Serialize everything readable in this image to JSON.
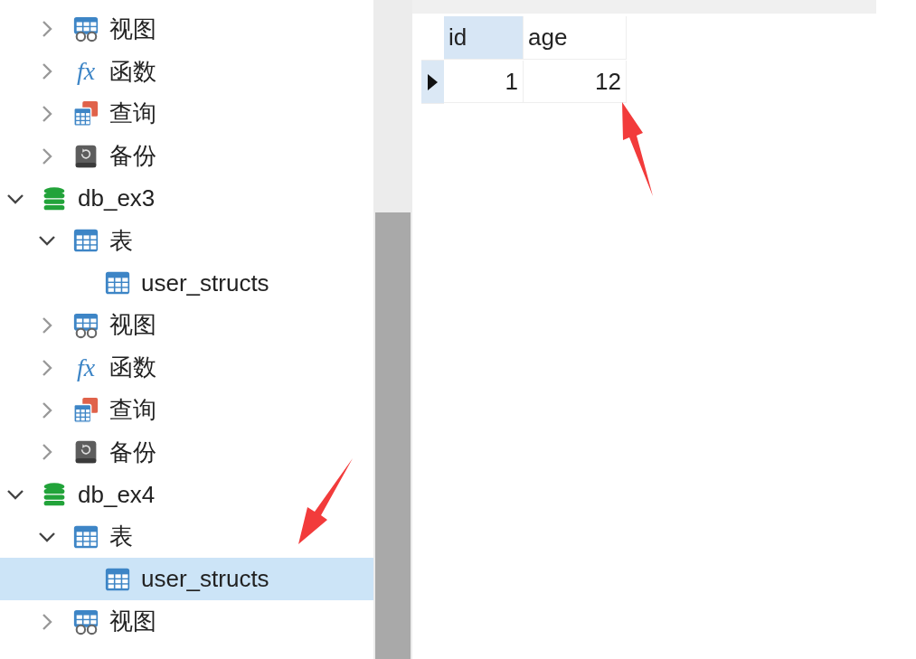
{
  "navigator": {
    "partial_group": [
      {
        "kind": "views",
        "label": "视图",
        "expanded": false,
        "selected": false
      },
      {
        "kind": "functions",
        "label": "函数",
        "glyph": "fx",
        "expanded": false,
        "selected": false
      },
      {
        "kind": "queries",
        "label": "查询",
        "expanded": false,
        "selected": false
      },
      {
        "kind": "backups",
        "label": "备份",
        "expanded": false,
        "selected": false
      }
    ],
    "databases": [
      {
        "kind": "database",
        "label": "db_ex3",
        "expanded": true,
        "selected": false,
        "children": [
          {
            "kind": "tables",
            "label": "表",
            "expanded": true,
            "selected": false,
            "children": [
              {
                "kind": "table",
                "label": "user_structs",
                "selected": false
              }
            ]
          },
          {
            "kind": "views",
            "label": "视图",
            "expanded": false,
            "selected": false
          },
          {
            "kind": "functions",
            "label": "函数",
            "glyph": "fx",
            "expanded": false,
            "selected": false
          },
          {
            "kind": "queries",
            "label": "查询",
            "expanded": false,
            "selected": false
          },
          {
            "kind": "backups",
            "label": "备份",
            "expanded": false,
            "selected": false
          }
        ]
      },
      {
        "kind": "database",
        "label": "db_ex4",
        "expanded": true,
        "selected": false,
        "children": [
          {
            "kind": "tables",
            "label": "表",
            "expanded": true,
            "selected": false,
            "children": [
              {
                "kind": "table",
                "label": "user_structs",
                "selected": true
              }
            ]
          },
          {
            "kind": "views",
            "label": "视图",
            "expanded": false,
            "selected": false
          }
        ]
      }
    ]
  },
  "grid": {
    "columns": [
      {
        "label": "id",
        "selected": true
      },
      {
        "label": "age",
        "selected": false
      }
    ],
    "rows": [
      {
        "cells": [
          "1",
          "12"
        ],
        "current": true
      }
    ]
  }
}
